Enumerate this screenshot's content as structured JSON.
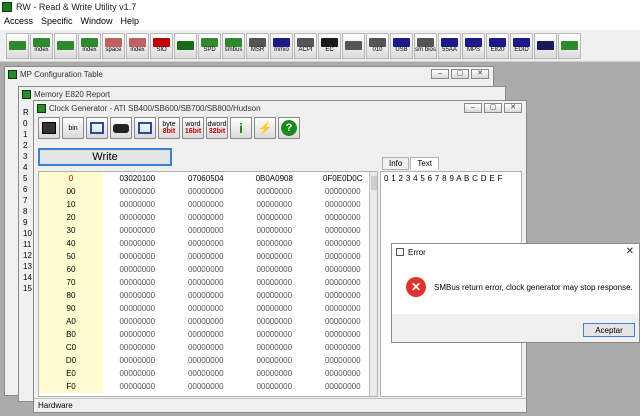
{
  "app": {
    "title": "RW - Read & Write Utility v1.7"
  },
  "menu": [
    "Access",
    "Specific",
    "Window",
    "Help"
  ],
  "toolbar": {
    "buttons": [
      {
        "name": "pci-icon",
        "label": "",
        "color": "#2f8a2f"
      },
      {
        "name": "index-icon",
        "label": "index",
        "color": "#2f8a2f"
      },
      {
        "name": "memory-icon",
        "label": "",
        "color": "#2f8a2f"
      },
      {
        "name": "index-icon",
        "label": "index",
        "color": "#2f8a2f"
      },
      {
        "name": "io-space-icon",
        "label": "space",
        "color": "#c06060"
      },
      {
        "name": "index-icon",
        "label": "index",
        "color": "#c06060"
      },
      {
        "name": "sio-icon",
        "label": "SIO",
        "color": "#c00000"
      },
      {
        "name": "wave-icon",
        "label": "",
        "color": "#1a6a1a"
      },
      {
        "name": "spd-icon",
        "label": "SPD",
        "color": "#2f8a2f"
      },
      {
        "name": "smbus-icon",
        "label": "smbus",
        "color": "#2f8a2f"
      },
      {
        "name": "msr-icon",
        "label": "MSR",
        "color": "#555555"
      },
      {
        "name": "mmio-icon",
        "label": "mmio",
        "color": "#1a1a8a"
      },
      {
        "name": "acpi-icon",
        "label": "ACPI",
        "color": "#555555"
      },
      {
        "name": "ec-icon",
        "label": "EC",
        "color": "#1a1a1a"
      },
      {
        "name": "disk-icon",
        "label": "",
        "color": "#555555"
      },
      {
        "name": "cmos-icon",
        "label": "010",
        "color": "#555555"
      },
      {
        "name": "usb-icon",
        "label": "USB",
        "color": "#1a1a8a"
      },
      {
        "name": "smbios-icon",
        "label": "sm bios",
        "color": "#555555"
      },
      {
        "name": "55aa-icon",
        "label": "55AA",
        "color": "#1a1a8a"
      },
      {
        "name": "mps-icon",
        "label": "MPS",
        "color": "#1a1a8a"
      },
      {
        "name": "e820-icon",
        "label": "E820",
        "color": "#1a1a8a"
      },
      {
        "name": "edid-icon",
        "label": "EDID",
        "color": "#1a1a8a"
      },
      {
        "name": "cmd-icon",
        "label": "",
        "color": "#1a1a5a"
      },
      {
        "name": "chip-icon",
        "label": "",
        "color": "#2f8a2f"
      }
    ]
  },
  "windows": {
    "mp_config": "MP Configuration Table",
    "memory_e820": "Memory E820 Report",
    "clock": {
      "title": "Clock Generator - ATI SB400/SB600/SB700/SB800/Hudson",
      "tool_labels": [
        {
          "top": "byte",
          "bottom": "8bit"
        },
        {
          "top": "word",
          "bottom": "16bit"
        },
        {
          "top": "dword",
          "bottom": "32bit"
        }
      ],
      "write_label": "Write",
      "tabs": [
        "Info",
        "Text"
      ],
      "text_content": "0 1 2 3 4 5 6 7 8 9 A B C D E F",
      "status": "Hardware",
      "columns": [
        "0",
        "03020100",
        "07060504",
        "0B0A0908",
        "0F0E0D0C"
      ],
      "rows": [
        {
          "label": "00",
          "cells": [
            "00000000",
            "00000000",
            "00000000",
            "00000000"
          ]
        },
        {
          "label": "10",
          "cells": [
            "00000000",
            "00000000",
            "00000000",
            "00000000"
          ]
        },
        {
          "label": "20",
          "cells": [
            "00000000",
            "00000000",
            "00000000",
            "00000000"
          ]
        },
        {
          "label": "30",
          "cells": [
            "00000000",
            "00000000",
            "00000000",
            "00000000"
          ]
        },
        {
          "label": "40",
          "cells": [
            "00000000",
            "00000000",
            "00000000",
            "00000000"
          ]
        },
        {
          "label": "50",
          "cells": [
            "00000000",
            "00000000",
            "00000000",
            "00000000"
          ]
        },
        {
          "label": "60",
          "cells": [
            "00000000",
            "00000000",
            "00000000",
            "00000000"
          ]
        },
        {
          "label": "70",
          "cells": [
            "00000000",
            "00000000",
            "00000000",
            "00000000"
          ]
        },
        {
          "label": "80",
          "cells": [
            "00000000",
            "00000000",
            "00000000",
            "00000000"
          ]
        },
        {
          "label": "90",
          "cells": [
            "00000000",
            "00000000",
            "00000000",
            "00000000"
          ]
        },
        {
          "label": "A0",
          "cells": [
            "00000000",
            "00000000",
            "00000000",
            "00000000"
          ]
        },
        {
          "label": "B0",
          "cells": [
            "00000000",
            "00000000",
            "00000000",
            "00000000"
          ]
        },
        {
          "label": "C0",
          "cells": [
            "00000000",
            "00000000",
            "00000000",
            "00000000"
          ]
        },
        {
          "label": "D0",
          "cells": [
            "00000000",
            "00000000",
            "00000000",
            "00000000"
          ]
        },
        {
          "label": "E0",
          "cells": [
            "00000000",
            "00000000",
            "00000000",
            "00000000"
          ]
        },
        {
          "label": "F0",
          "cells": [
            "00000000",
            "00000000",
            "00000000",
            "00000000"
          ]
        }
      ]
    },
    "background_row_labels": [
      "R",
      "0",
      "1",
      "2",
      "3",
      "4",
      "5",
      "6",
      "7",
      "8",
      "9",
      "10",
      "11",
      "12",
      "13",
      "14",
      "15"
    ]
  },
  "error_dialog": {
    "title": "Error",
    "message": "SMBus return error, clock generator may stop response.",
    "ok_label": "Aceptar",
    "icon_color": "#e0342a"
  },
  "colors": {
    "accent": "#3c7fd8",
    "row_header_bg": "#fffdd0",
    "header_red": "#d40000"
  }
}
